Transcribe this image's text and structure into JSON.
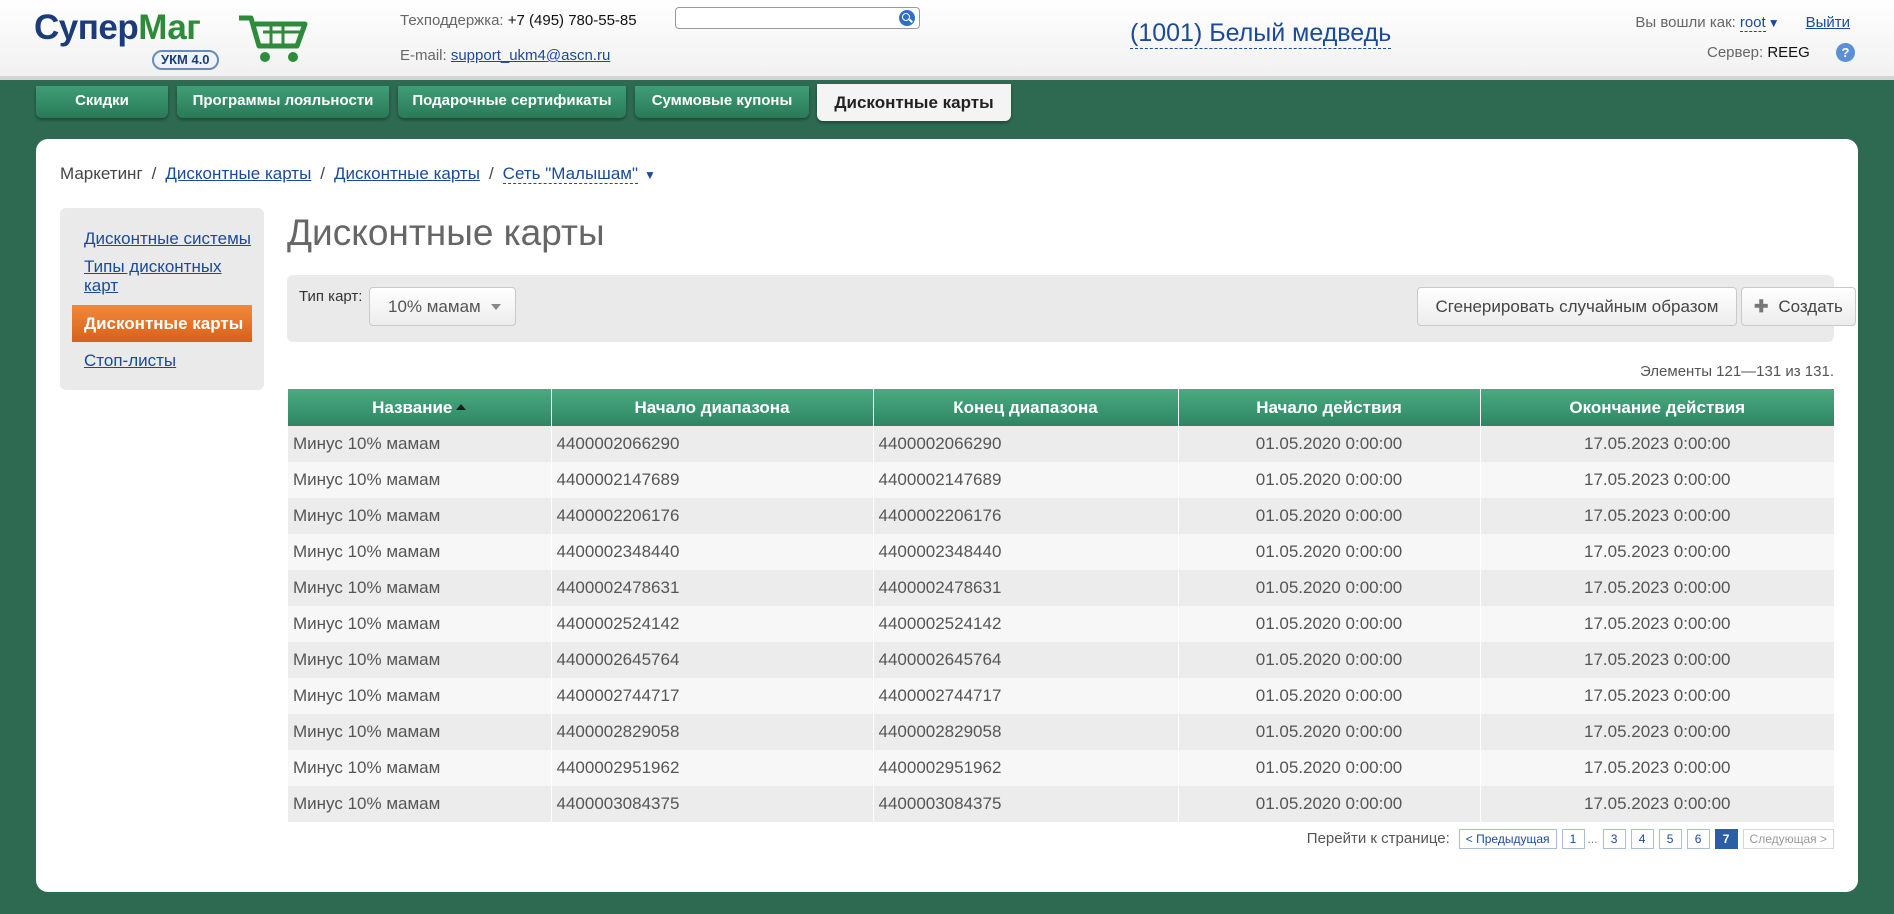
{
  "logo": {
    "text_a": "Супер",
    "text_b": "Маг",
    "badge": "УКМ 4.0"
  },
  "header": {
    "support_label": "Техподдержка:",
    "support_phone": "+7 (495) 780-55-85",
    "email_label": "E-mail:",
    "email": "support_ukm4@ascn.ru",
    "search": {
      "value": "",
      "placeholder": ""
    },
    "store": "(1001) Белый медведь",
    "logged_as_label": "Вы вошли как:",
    "user": "root",
    "logout": "Выйти",
    "server_label": "Сервер:",
    "server": "REEG",
    "help": "?"
  },
  "tabs": [
    {
      "label": "Скидки"
    },
    {
      "label": "Программы лояльности"
    },
    {
      "label": "Подарочные сертификаты"
    },
    {
      "label": "Суммовые купоны"
    },
    {
      "label": "Дисконтные карты"
    }
  ],
  "breadcrumb": {
    "root": "Маркетинг",
    "sep": "/",
    "link1": "Дисконтные карты",
    "link2": "Дисконтные карты",
    "current": "Сеть \"Малышам\""
  },
  "sidebar": {
    "items": [
      {
        "label": "Дисконтные системы"
      },
      {
        "label": "Типы дисконтных карт"
      },
      {
        "label": "Дисконтные карты"
      },
      {
        "label": "Стоп-листы"
      }
    ]
  },
  "page_title": "Дисконтные карты",
  "toolbar": {
    "type_label": "Тип карт:",
    "type_value": "10% мамам",
    "generate_label": "Сгенерировать случайным образом",
    "create_label": "Создать"
  },
  "counter": "Элементы 121—131 из 131.",
  "table": {
    "columns": [
      "Название",
      "Начало диапазона",
      "Конец диапазона",
      "Начало действия",
      "Окончание действия"
    ],
    "rows": [
      [
        "Минус 10% мамам",
        "4400002066290",
        "4400002066290",
        "01.05.2020 0:00:00",
        "17.05.2023 0:00:00"
      ],
      [
        "Минус 10% мамам",
        "4400002147689",
        "4400002147689",
        "01.05.2020 0:00:00",
        "17.05.2023 0:00:00"
      ],
      [
        "Минус 10% мамам",
        "4400002206176",
        "4400002206176",
        "01.05.2020 0:00:00",
        "17.05.2023 0:00:00"
      ],
      [
        "Минус 10% мамам",
        "4400002348440",
        "4400002348440",
        "01.05.2020 0:00:00",
        "17.05.2023 0:00:00"
      ],
      [
        "Минус 10% мамам",
        "4400002478631",
        "4400002478631",
        "01.05.2020 0:00:00",
        "17.05.2023 0:00:00"
      ],
      [
        "Минус 10% мамам",
        "4400002524142",
        "4400002524142",
        "01.05.2020 0:00:00",
        "17.05.2023 0:00:00"
      ],
      [
        "Минус 10% мамам",
        "4400002645764",
        "4400002645764",
        "01.05.2020 0:00:00",
        "17.05.2023 0:00:00"
      ],
      [
        "Минус 10% мамам",
        "4400002744717",
        "4400002744717",
        "01.05.2020 0:00:00",
        "17.05.2023 0:00:00"
      ],
      [
        "Минус 10% мамам",
        "4400002829058",
        "4400002829058",
        "01.05.2020 0:00:00",
        "17.05.2023 0:00:00"
      ],
      [
        "Минус 10% мамам",
        "4400002951962",
        "4400002951962",
        "01.05.2020 0:00:00",
        "17.05.2023 0:00:00"
      ],
      [
        "Минус 10% мамам",
        "4400003084375",
        "4400003084375",
        "01.05.2020 0:00:00",
        "17.05.2023 0:00:00"
      ]
    ]
  },
  "pager": {
    "label": "Перейти к странице:",
    "prev": "< Предыдущая",
    "pages": [
      "1",
      "...",
      "3",
      "4",
      "5",
      "6",
      "7"
    ],
    "current": "7",
    "next": "Следующая >"
  },
  "colors": {
    "background": "#2e6a52",
    "tab_green": "#3f9e76",
    "active_side": "#e8742a",
    "link": "#1a4a9a"
  }
}
